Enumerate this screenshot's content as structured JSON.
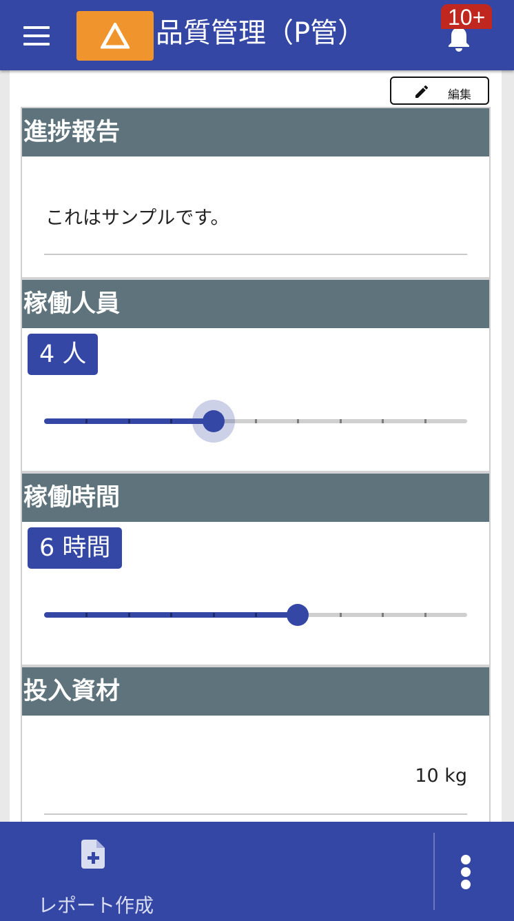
{
  "header": {
    "title": "品質管理（P管）",
    "badge": "10+",
    "icons": [
      "menu-icon",
      "warning-triangle-icon",
      "bell-icon"
    ]
  },
  "toolbar": {
    "edit_label": "編集",
    "edit_icon": "pencil-icon"
  },
  "sections": {
    "progress": {
      "title": "進捗報告",
      "text": "これはサンプルです。"
    },
    "staff": {
      "title": "稼働人員",
      "value_label": "4 人",
      "value": 4,
      "max": 10
    },
    "hours": {
      "title": "稼働時間",
      "value_label": "6 時間",
      "value": 6,
      "max": 10
    },
    "materials": {
      "title": "投入資材",
      "value_label": "10 kg"
    }
  },
  "footer": {
    "create_label": "レポート作成",
    "create_icon": "file-plus-icon",
    "more_icon": "more-vertical-icon"
  },
  "colors": {
    "primary": "#3547a5",
    "warning": "#f0952e",
    "badge": "#c0271e",
    "section_header": "#5f737c"
  }
}
